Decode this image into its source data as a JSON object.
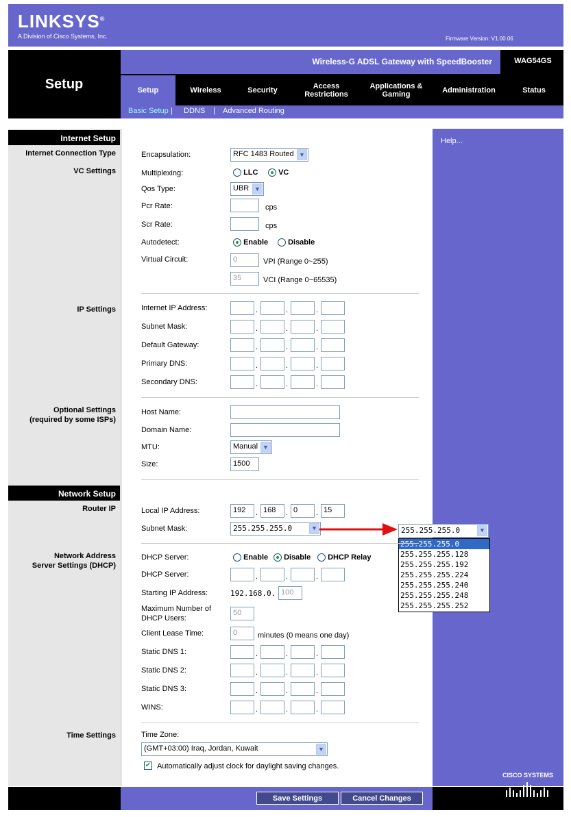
{
  "header": {
    "brand": "LINKSYS",
    "brand_mark": "®",
    "brand_subtitle": "A Division of Cisco Systems, Inc.",
    "firmware": "Firmware Version: V1.00.06",
    "product_name": "Wireless-G ADSL Gateway with SpeedBooster",
    "model": "WAG54GS",
    "page_title": "Setup"
  },
  "tabs": [
    {
      "label": "Setup",
      "active": true
    },
    {
      "label": "Wireless"
    },
    {
      "label": "Security"
    },
    {
      "label": "Access Restrictions"
    },
    {
      "label": "Applications & Gaming"
    },
    {
      "label": "Administration"
    },
    {
      "label": "Status"
    }
  ],
  "subnav": [
    "Basic Setup",
    "DDNS",
    "Advanced Routing"
  ],
  "sections": {
    "internet_setup": "Internet Setup",
    "network_setup": "Network Setup"
  },
  "left_labels": {
    "connection_type": "Internet Connection Type",
    "vc_settings": "VC Settings",
    "ip_settings": "IP Settings",
    "optional_1": "Optional Settings",
    "optional_2": "(required by some ISPs)",
    "router_ip": "Router IP",
    "dhcp_1": "Network Address",
    "dhcp_2": "Server Settings (DHCP)",
    "time_settings": "Time Settings"
  },
  "help": "Help...",
  "internet": {
    "encapsulation_label": "Encapsulation:",
    "encapsulation_value": "RFC 1483 Routed",
    "multiplexing_label": "Multiplexing:",
    "mux_llc": "LLC",
    "mux_vc": "VC",
    "qos_label": "Qos Type:",
    "qos_value": "UBR",
    "pcr_label": "Pcr Rate:",
    "scr_label": "Scr Rate:",
    "cps": "cps",
    "autodetect_label": "Autodetect:",
    "enable": "Enable",
    "disable": "Disable",
    "vc_label": "Virtual Circuit:",
    "vpi_value": "0",
    "vpi_range": "VPI (Range 0~255)",
    "vci_value": "35",
    "vci_range": "VCI (Range 0~65535)"
  },
  "ip": {
    "internet_ip": "Internet IP Address:",
    "subnet": "Subnet Mask:",
    "gateway": "Default Gateway:",
    "dns1": "Primary DNS:",
    "dns2": "Secondary DNS:"
  },
  "optional": {
    "host": "Host Name:",
    "domain": "Domain Name:",
    "mtu_label": "MTU:",
    "mtu_value": "Manual",
    "size_label": "Size:",
    "size_value": "1500"
  },
  "router": {
    "local_ip_label": "Local IP Address:",
    "ip": [
      "192",
      "168",
      "0",
      "15"
    ],
    "subnet_label": "Subnet Mask:",
    "subnet_value": "255.255.255.0"
  },
  "dhcp": {
    "server_label": "DHCP Server:",
    "opt_enable": "Enable",
    "opt_disable": "Disable",
    "opt_relay": "DHCP Relay",
    "server_ip_label": "DHCP Server:",
    "start_label": "Starting IP Address:",
    "start_prefix": "192.168.0.",
    "start_value": "100",
    "max_label_1": "Maximum Number of",
    "max_label_2": "DHCP Users:",
    "max_value": "50",
    "lease_label": "Client Lease Time:",
    "lease_value": "0",
    "lease_unit": "minutes (0 means one day)",
    "sdns1": "Static DNS 1:",
    "sdns2": "Static DNS 2:",
    "sdns3": "Static DNS 3:",
    "wins": "WINS:"
  },
  "time": {
    "zone_label": "Time Zone:",
    "zone_value": "(GMT+03:00) Iraq, Jordan, Kuwait",
    "dst_label": "Automatically adjust clock for daylight saving changes."
  },
  "buttons": {
    "save": "Save Settings",
    "cancel": "Cancel Changes"
  },
  "subnet_dropdown": {
    "selected": "255.255.255.0",
    "options": [
      "255.255.255.0",
      "255.255.255.128",
      "255.255.255.192",
      "255.255.255.224",
      "255.255.255.240",
      "255.255.255.248",
      "255.255.255.252"
    ]
  },
  "footer_logo": "CISCO SYSTEMS",
  "colors": {
    "brand_purple": "#6666cc",
    "arrow_red": "#e01010",
    "select_highlight": "#316ac5"
  }
}
